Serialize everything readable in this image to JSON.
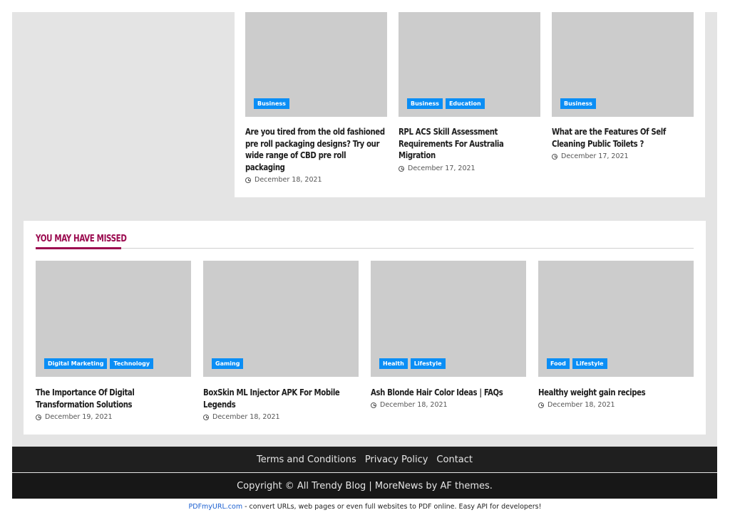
{
  "related_posts": [
    {
      "categories": [
        "Business"
      ],
      "title": "Are you tired from the old fashioned pre roll packaging designs? Try our wide range of CBD pre roll packaging",
      "date": "December 18, 2021"
    },
    {
      "categories": [
        "Business",
        "Education"
      ],
      "title": "RPL ACS Skill Assessment Requirements For Australia Migration",
      "date": "December 17, 2021"
    },
    {
      "categories": [
        "Business"
      ],
      "title": "What are the Features Of Self Cleaning Public Toilets ?",
      "date": "December 17, 2021"
    }
  ],
  "missed": {
    "heading": "YOU MAY HAVE MISSED",
    "posts": [
      {
        "categories": [
          "Digital Marketing",
          "Technology"
        ],
        "title": "The Importance Of Digital Transformation Solutions",
        "date": "December 19, 2021"
      },
      {
        "categories": [
          "Gaming"
        ],
        "title": "BoxSkin ML Injector APK For Mobile Legends",
        "date": "December 18, 2021"
      },
      {
        "categories": [
          "Health",
          "Lifestyle"
        ],
        "title": "Ash Blonde Hair Color Ideas | FAQs",
        "date": "December 18, 2021"
      },
      {
        "categories": [
          "Food",
          "Lifestyle"
        ],
        "title": "Healthy weight gain recipes",
        "date": "December 18, 2021"
      }
    ]
  },
  "footer": {
    "menu": [
      "Terms and Conditions",
      "Privacy Policy",
      "Contact"
    ],
    "copyright": "Copyright © All Trendy Blog | MoreNews by AF themes."
  },
  "pdf_bar": {
    "link": "PDFmyURL.com",
    "text": " - convert URLs, web pages or even full websites to PDF online. Easy API for developers!"
  },
  "colors": {
    "accent": "#9b0a4f",
    "category_badge": "#0b8ef5",
    "footer_bg": "#1f1f1f"
  },
  "icons": {
    "date": "clock-icon"
  }
}
